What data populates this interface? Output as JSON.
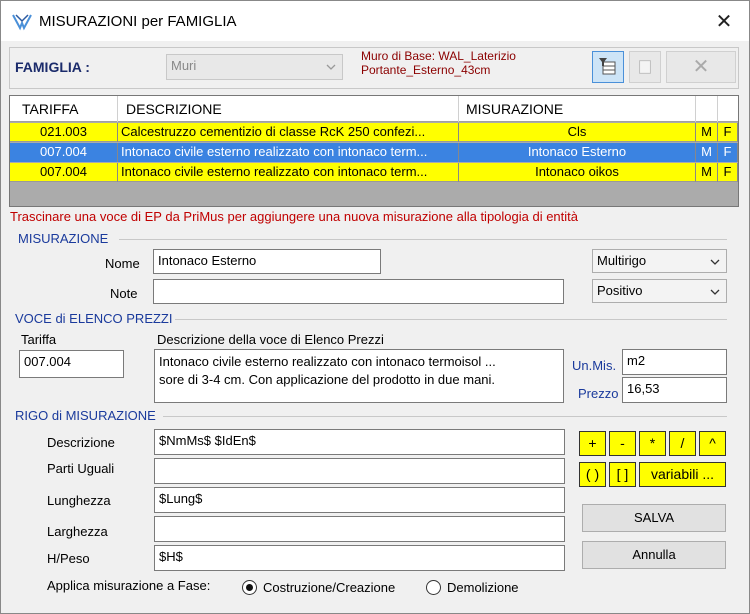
{
  "window": {
    "title": "MISURAZIONI per FAMIGLIA"
  },
  "famiglia": {
    "label": "FAMIGLIA :",
    "value": "Muri",
    "info_line1": "Muro di Base: WAL_Laterizio",
    "info_line2": "Portante_Esterno_43cm"
  },
  "grid": {
    "headers": [
      "TARIFFA",
      "DESCRIZIONE",
      "MISURAZIONE"
    ],
    "rows": [
      {
        "tariffa": "021.003",
        "descrizione": "Calcestruzzo cementizio di classe RcK 250 confezi...",
        "misurazione": "Cls",
        "m": "M",
        "f": "F",
        "style": "yellow"
      },
      {
        "tariffa": "007.004",
        "descrizione": "Intonaco civile esterno realizzato con intonaco term...",
        "misurazione": "Intonaco Esterno",
        "m": "M",
        "f": "F",
        "style": "blue"
      },
      {
        "tariffa": "007.004",
        "descrizione": "Intonaco civile esterno realizzato con intonaco term...",
        "misurazione": "Intonaco oikos",
        "m": "M",
        "f": "F",
        "style": "yellow"
      }
    ]
  },
  "hint": "Trascinare una voce di EP da PriMus per aggiungere una nuova misurazione alla tipologia di entità",
  "misurazione": {
    "section": "MISURAZIONE",
    "nome_label": "Nome",
    "nome_value": "Intonaco Esterno",
    "note_label": "Note",
    "note_value": "",
    "tipo": "Multirigo",
    "segno": "Positivo"
  },
  "voce": {
    "section": "VOCE di ELENCO PREZZI",
    "tariffa_label": "Tariffa",
    "tariffa_value": "007.004",
    "descr_label": "Descrizione della voce di Elenco Prezzi",
    "descr_line1": "Intonaco civile esterno realizzato con intonaco termoisol ...",
    "descr_line2": "sore di 3-4 cm. Con applicazione del prodotto in due mani.",
    "um_label": "Un.Mis.",
    "um_value": "m2",
    "prezzo_label": "Prezzo",
    "prezzo_value": "16,53"
  },
  "rigo": {
    "section": "RIGO di MISURAZIONE",
    "descrizione_label": "Descrizione",
    "descrizione_value": "$NmMs$ $IdEn$",
    "parti_label": "Parti Uguali",
    "parti_value": "",
    "lunghezza_label": "Lunghezza",
    "lunghezza_value": "$Lung$",
    "larghezza_label": "Larghezza",
    "larghezza_value": "",
    "hpeso_label": "H/Peso",
    "hpeso_value": "$H$",
    "ops": [
      "+",
      "-",
      "*",
      "/",
      "^"
    ],
    "ops2": [
      "( )",
      "[ ]",
      "variabili ..."
    ],
    "salva": "SALVA",
    "annulla": "Annulla"
  },
  "fase": {
    "label": "Applica misurazione a Fase:",
    "opt1": "Costruzione/Creazione",
    "opt2": "Demolizione",
    "selected": "opt1"
  },
  "colors": {
    "yellow": "#ffff00",
    "selection": "#3b83e1",
    "section": "#1a3a9c",
    "hint": "#c00000"
  }
}
